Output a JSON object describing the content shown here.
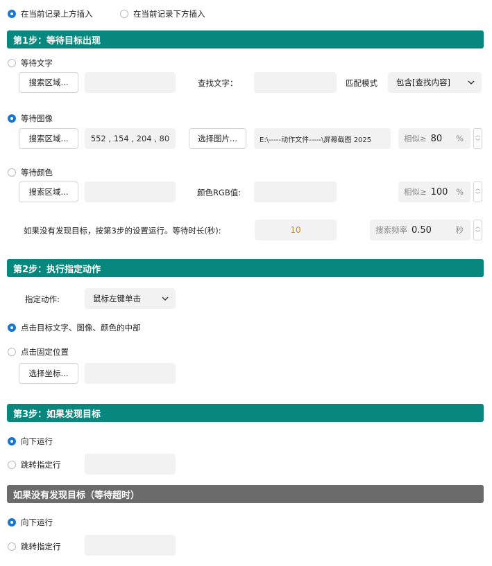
{
  "insert_position": {
    "above_label": "在当前记录上方插入",
    "below_label": "在当前记录下方插入",
    "selected": "above"
  },
  "step1": {
    "title": "第1步：等待目标出现",
    "wait_text": {
      "label": "等待文字",
      "selected": false,
      "search_area_button": "搜索区域...",
      "search_area_value": "",
      "find_text_label": "查找文字：",
      "find_text_value": "",
      "match_mode_label": "匹配模式",
      "match_mode_value": "包含[查找内容]"
    },
    "wait_image": {
      "label": "等待图像",
      "selected": true,
      "search_area_button": "搜索区域...",
      "search_area_value": "552 , 154 , 204 , 80",
      "select_image_button": "选择图片...",
      "image_path": "E:\\-----动作文件-----\\屏幕截图 2025",
      "similar_prefix": "相似≥",
      "similar_value": "80",
      "similar_unit": "%"
    },
    "wait_color": {
      "label": "等待颜色",
      "selected": false,
      "search_area_button": "搜索区域...",
      "search_area_value": "",
      "rgb_label": "颜色RGB值:",
      "rgb_value": "",
      "similar_prefix": "相似≥",
      "similar_value": "100",
      "similar_unit": "%"
    },
    "timeout": {
      "label": "如果没有发现目标，按第3步的设置运行。等待时长(秒):",
      "value": "10",
      "freq_prefix": "搜索频率",
      "freq_value": "0.50",
      "freq_unit": "秒"
    }
  },
  "step2": {
    "title": "第2步：执行指定动作",
    "action_label": "指定动作:",
    "action_value": "鼠标左键单击",
    "click_center_label": "点击目标文字、图像、颜色的中部",
    "click_center_selected": true,
    "click_fixed_label": "点击固定位置",
    "click_fixed_selected": false,
    "choose_coord_button": "选择坐标...",
    "coord_value": ""
  },
  "step3": {
    "title": "第3步：如果发现目标",
    "run_down_label": "向下运行",
    "run_down_selected": true,
    "jump_label": "跳转指定行",
    "jump_selected": false,
    "jump_value": ""
  },
  "timeout_section": {
    "title": "如果没有发现目标（等待超时）",
    "run_down_label": "向下运行",
    "run_down_selected": true,
    "jump_label": "跳转指定行",
    "jump_selected": false,
    "jump_value": ""
  },
  "colors": {
    "accent": "#1976d2",
    "header_teal": "#07877d",
    "header_gray": "#6b6b6b",
    "timeout_value": "#d28a1e"
  }
}
